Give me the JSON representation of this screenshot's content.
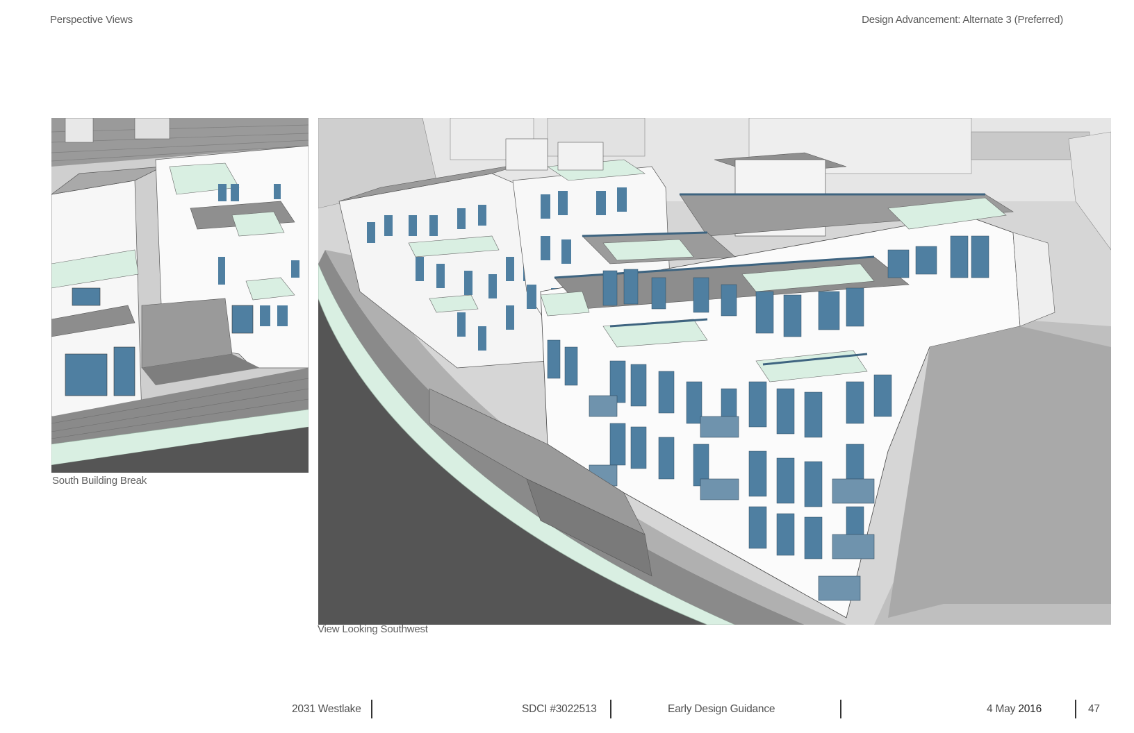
{
  "header": {
    "section": "Perspective Views",
    "title": "Design Advancement: Alternate 3 (Preferred)"
  },
  "figures": {
    "left_caption": "South Building Break",
    "right_caption": "View Looking Southwest"
  },
  "footer": {
    "project": "2031 Westlake",
    "permit": "SDCI #3022513",
    "phase": "Early Design Guidance",
    "date_day_month": "4 May",
    "date_year": "2016",
    "page_number": "47"
  },
  "colors": {
    "roof_green": "#d9efe2",
    "glass_blue": "#4f7fa1",
    "building_white": "#fdfdfd",
    "ground_gray": "#6e6e6e"
  }
}
